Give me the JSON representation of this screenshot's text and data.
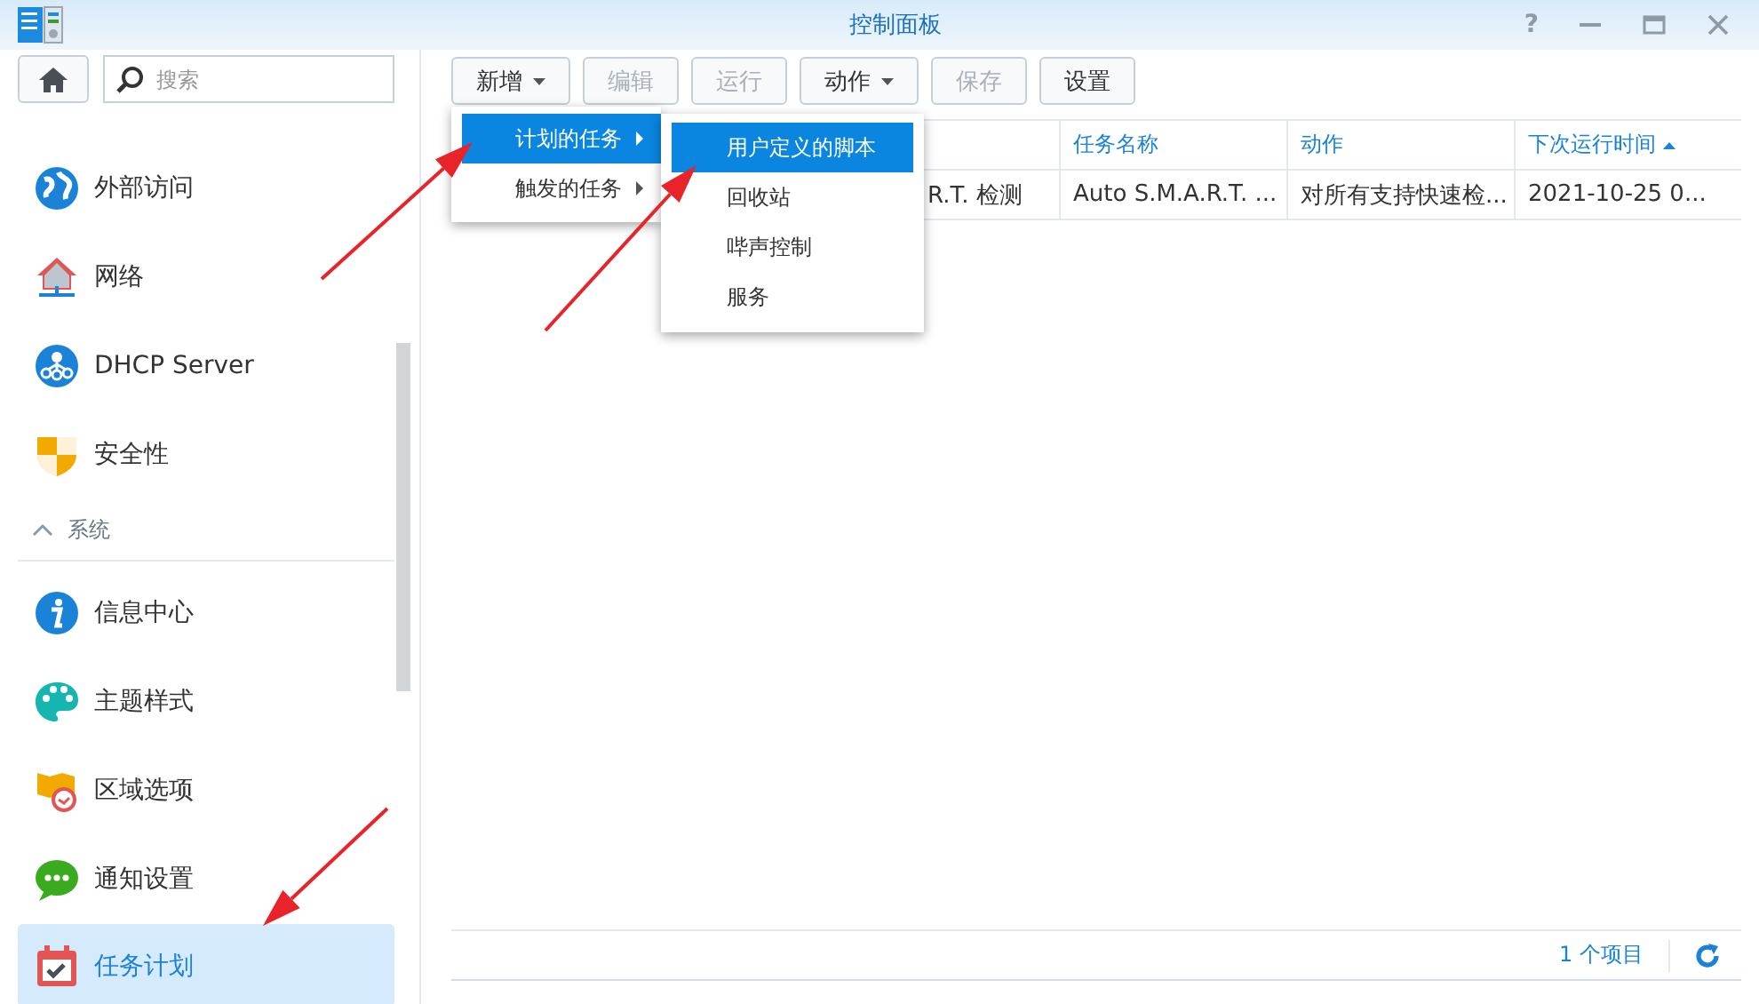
{
  "window": {
    "title": "控制面板",
    "help": "?"
  },
  "sidebar": {
    "search": {
      "placeholder": "搜索"
    },
    "items": [
      {
        "kind": "item",
        "label": "外部访问",
        "selected": false
      },
      {
        "kind": "item",
        "label": "网络",
        "selected": false
      },
      {
        "kind": "item",
        "label": "DHCP Server",
        "selected": false
      },
      {
        "kind": "item",
        "label": "安全性",
        "selected": false
      },
      {
        "kind": "header",
        "label": "系统",
        "expanded": true
      },
      {
        "kind": "item",
        "label": "信息中心",
        "selected": false
      },
      {
        "kind": "item",
        "label": "主题样式",
        "selected": false
      },
      {
        "kind": "item",
        "label": "区域选项",
        "selected": false
      },
      {
        "kind": "item",
        "label": "通知设置",
        "selected": false
      },
      {
        "kind": "item",
        "label": "任务计划",
        "selected": true
      }
    ]
  },
  "toolbar": [
    {
      "label": "新增",
      "dropdown": true,
      "disabled": false
    },
    {
      "label": "编辑",
      "dropdown": false,
      "disabled": true
    },
    {
      "label": "运行",
      "dropdown": false,
      "disabled": true
    },
    {
      "label": "动作",
      "dropdown": true,
      "disabled": false
    },
    {
      "label": "保存",
      "dropdown": false,
      "disabled": true
    },
    {
      "label": "设置",
      "dropdown": false,
      "disabled": false
    }
  ],
  "menu": [
    {
      "label": "计划的任务",
      "selected": true
    },
    {
      "label": "触发的任务",
      "selected": false
    }
  ],
  "submenu": [
    {
      "label": "用户定义的脚本",
      "selected": true
    },
    {
      "label": "回收站",
      "selected": false
    },
    {
      "label": "哔声控制",
      "selected": false
    },
    {
      "label": "服务",
      "selected": false
    }
  ],
  "table": {
    "columns": [
      {
        "sorted": false
      },
      {
        "label": "任务名称",
        "sorted": false
      },
      {
        "label": "动作",
        "sorted": false
      },
      {
        "label": "下次运行时间",
        "sorted": true
      }
    ],
    "rows": [
      {
        "cells": [
          "R.T. 检测",
          "Auto S.M.A.R.T. ...",
          "对所有支持快速检...",
          "2021-10-25 0..."
        ]
      }
    ]
  },
  "status_bar": {
    "count": "1 个项目"
  }
}
